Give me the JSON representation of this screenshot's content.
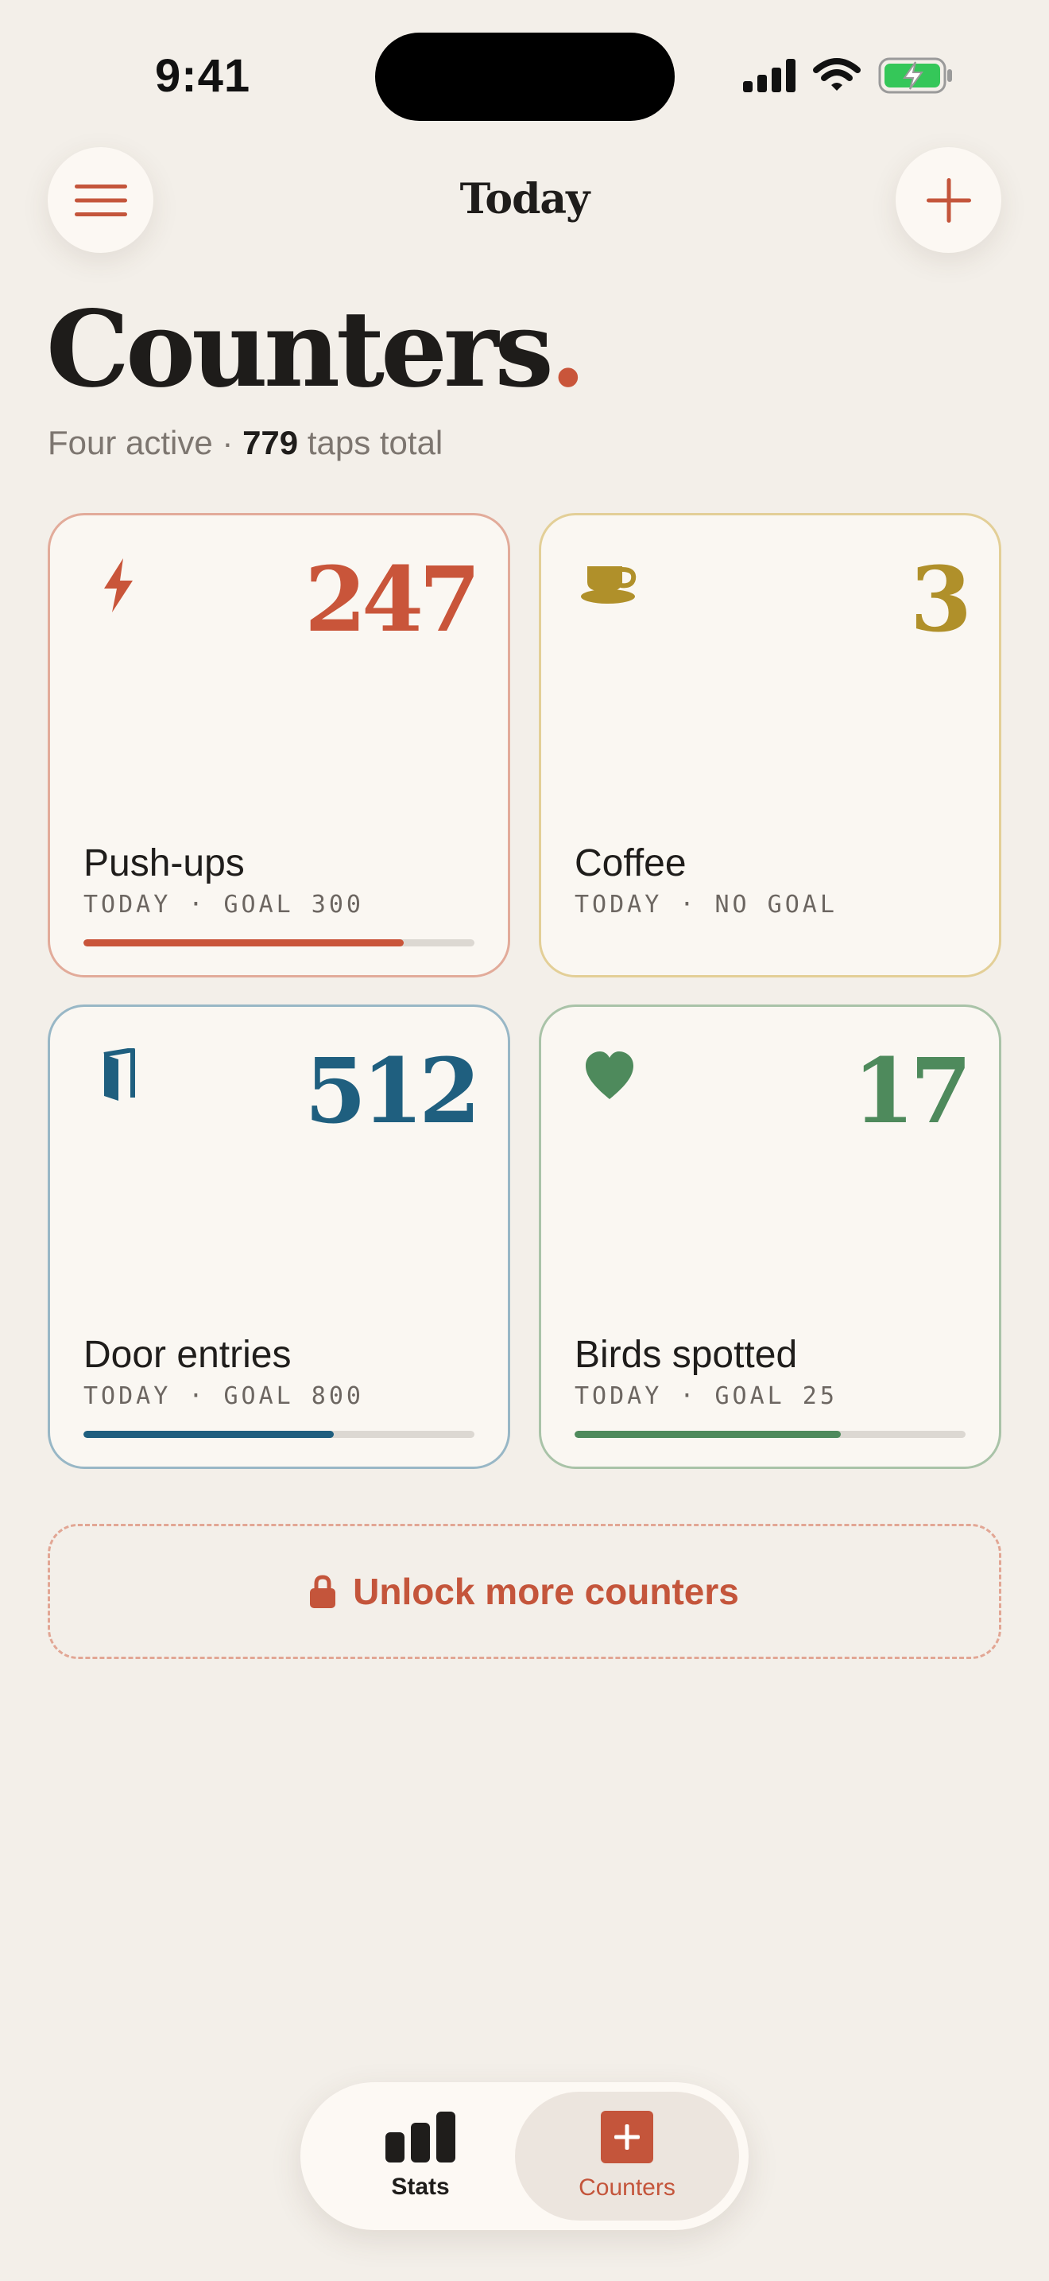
{
  "status_bar": {
    "time": "9:41",
    "icons": [
      "signal-icon",
      "wifi-icon",
      "battery-charging-icon"
    ]
  },
  "header": {
    "title": "Today",
    "menu_icon": "hamburger-icon",
    "add_icon": "plus-icon"
  },
  "page": {
    "title": "Counters",
    "title_dot": ".",
    "subtitle_prefix": "Four active · ",
    "subtitle_total": "779",
    "subtitle_suffix": " taps total"
  },
  "counters": [
    {
      "name": "Push-ups",
      "count": "247",
      "meta": "TODAY · GOAL 300",
      "icon": "bolt-icon",
      "color": "#c9553a",
      "progress": 0.82
    },
    {
      "name": "Coffee",
      "count": "3",
      "meta": "TODAY · NO GOAL",
      "icon": "coffee-cup-icon",
      "color": "#b0902a",
      "progress": null
    },
    {
      "name": "Door entries",
      "count": "512",
      "meta": "TODAY · GOAL 800",
      "icon": "door-icon",
      "color": "#1f5f7f",
      "progress": 0.64
    },
    {
      "name": "Birds spotted",
      "count": "17",
      "meta": "TODAY · GOAL 25",
      "icon": "heart-icon",
      "color": "#4e8a5c",
      "progress": 0.68
    }
  ],
  "unlock": {
    "label": "Unlock more counters",
    "icon": "lock-icon",
    "color": "#c4553b"
  },
  "tabbar": {
    "tabs": [
      {
        "label": "Stats",
        "icon": "bar-chart-icon",
        "active": false
      },
      {
        "label": "Counters",
        "icon": "plus-square-icon",
        "active": true
      }
    ],
    "accent": "#c4553b"
  }
}
